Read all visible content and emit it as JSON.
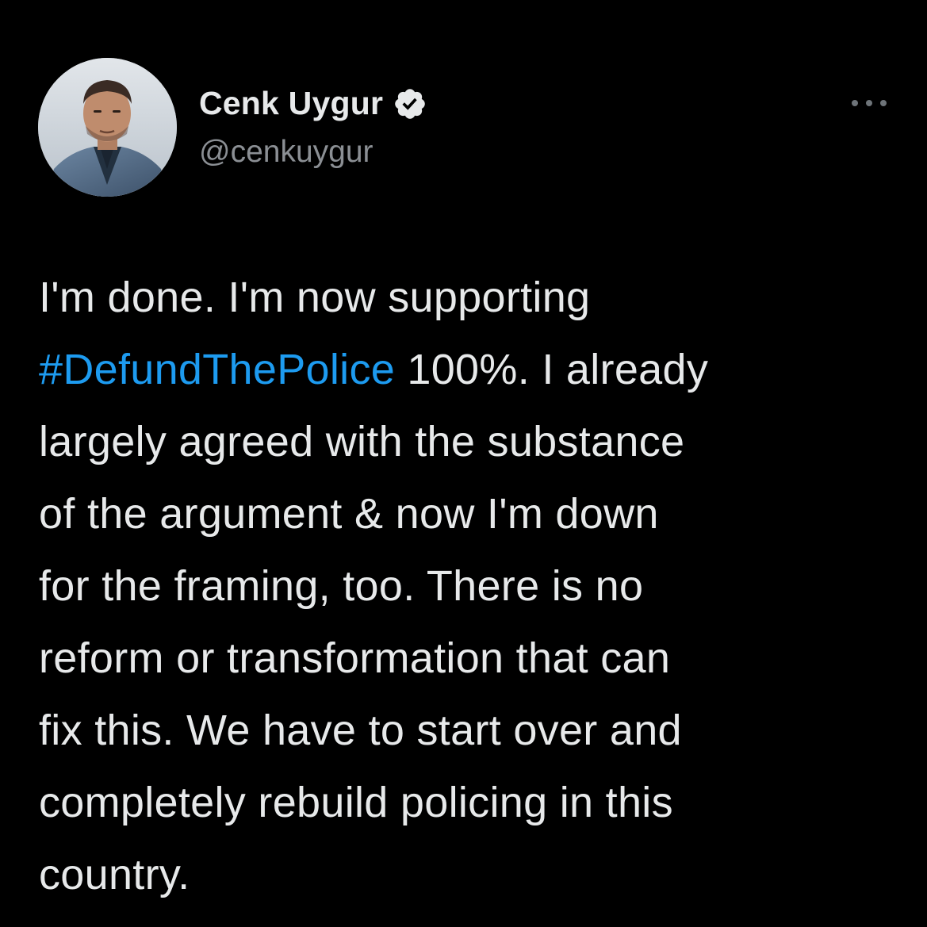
{
  "author": {
    "display_name": "Cenk Uygur",
    "handle": "@cenkuygur",
    "verified": true,
    "verified_icon": "verified-badge-icon",
    "avatar_icon": "profile-photo"
  },
  "more_icon": "more-options-icon",
  "tweet": {
    "line1": "I'm done. I'm now supporting",
    "hashtag": "#DefundThePolice",
    "line2_rest": " 100%. I already",
    "line3": "largely agreed with the substance",
    "line4": "of the argument & now I'm down",
    "line5": "for the framing, too. There is no",
    "line6": "reform or transformation that can",
    "line7": "fix this. We have to start over and",
    "line8": "completely rebuild policing in this",
    "line9": "country."
  },
  "colors": {
    "background": "#000000",
    "text": "#e7e9ea",
    "secondary_text": "#8b8f94",
    "link": "#1d9bf0"
  }
}
